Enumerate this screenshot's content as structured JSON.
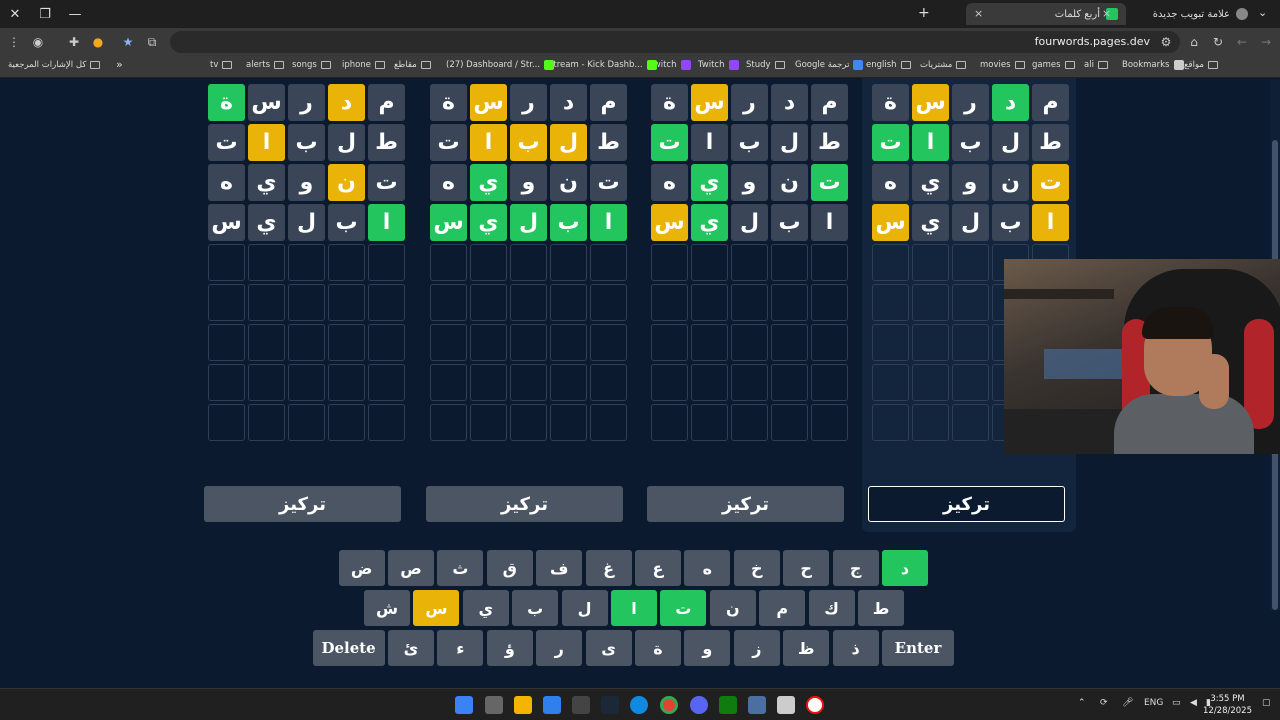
{
  "browser": {
    "tabs": [
      {
        "title": "أربع كلمات",
        "active": true
      },
      {
        "title": "علامة تبويب جديدة",
        "active": false
      }
    ],
    "new_tab_symbol": "+",
    "close_symbol": "×",
    "url": "fourwords.pages.dev",
    "bookmarks_bar": [
      {
        "label": "Bookmarks",
        "icon": "star-icon"
      },
      {
        "label": "مواقع",
        "icon": "folder-icon"
      },
      {
        "label": "ali",
        "icon": "folder-icon"
      },
      {
        "label": "games",
        "icon": "folder-icon"
      },
      {
        "label": "movies",
        "icon": "folder-icon"
      },
      {
        "label": "مشتريات",
        "icon": "folder-icon"
      },
      {
        "label": "english",
        "icon": "folder-icon"
      },
      {
        "label": "Google ترجمة",
        "icon": "translate-icon"
      },
      {
        "label": "Study",
        "icon": "folder-icon"
      },
      {
        "label": "Twitch",
        "icon": "twitch-icon"
      },
      {
        "label": "Twitch",
        "icon": "twitch-icon"
      },
      {
        "label": "Stream - Kick Dashb...",
        "icon": "kick-icon"
      },
      {
        "label": "(27) Dashboard / Str...",
        "icon": "kick-icon"
      },
      {
        "label": "مقاطع",
        "icon": "folder-icon"
      },
      {
        "label": "iphone",
        "icon": "folder-icon"
      },
      {
        "label": "songs",
        "icon": "folder-icon"
      },
      {
        "label": "alerts",
        "icon": "folder-icon"
      },
      {
        "label": "tv",
        "icon": "folder-icon"
      }
    ],
    "all_bookmarks": "كل الإشارات المرجعية",
    "overflow": "»"
  },
  "game": {
    "boards": [
      {
        "rows": [
          [
            {
              "l": "م",
              "s": "gray"
            },
            {
              "l": "د",
              "s": "green"
            },
            {
              "l": "ر",
              "s": "gray"
            },
            {
              "l": "س",
              "s": "yellow"
            },
            {
              "l": "ة",
              "s": "gray"
            }
          ],
          [
            {
              "l": "ط",
              "s": "gray"
            },
            {
              "l": "ل",
              "s": "gray"
            },
            {
              "l": "ب",
              "s": "gray"
            },
            {
              "l": "ا",
              "s": "green"
            },
            {
              "l": "ت",
              "s": "green"
            }
          ],
          [
            {
              "l": "ت",
              "s": "yellow"
            },
            {
              "l": "ن",
              "s": "gray"
            },
            {
              "l": "و",
              "s": "gray"
            },
            {
              "l": "ي",
              "s": "gray"
            },
            {
              "l": "ه",
              "s": "gray"
            }
          ],
          [
            {
              "l": "ا",
              "s": "yellow"
            },
            {
              "l": "ب",
              "s": "gray"
            },
            {
              "l": "ل",
              "s": "gray"
            },
            {
              "l": "ي",
              "s": "gray"
            },
            {
              "l": "س",
              "s": "yellow"
            }
          ]
        ],
        "focus_label": "تركيز",
        "active": true
      },
      {
        "rows": [
          [
            {
              "l": "م",
              "s": "gray"
            },
            {
              "l": "د",
              "s": "gray"
            },
            {
              "l": "ر",
              "s": "gray"
            },
            {
              "l": "س",
              "s": "yellow"
            },
            {
              "l": "ة",
              "s": "gray"
            }
          ],
          [
            {
              "l": "ط",
              "s": "gray"
            },
            {
              "l": "ل",
              "s": "gray"
            },
            {
              "l": "ب",
              "s": "gray"
            },
            {
              "l": "ا",
              "s": "gray"
            },
            {
              "l": "ت",
              "s": "green"
            }
          ],
          [
            {
              "l": "ت",
              "s": "green"
            },
            {
              "l": "ن",
              "s": "gray"
            },
            {
              "l": "و",
              "s": "gray"
            },
            {
              "l": "ي",
              "s": "green"
            },
            {
              "l": "ه",
              "s": "gray"
            }
          ],
          [
            {
              "l": "ا",
              "s": "gray"
            },
            {
              "l": "ب",
              "s": "gray"
            },
            {
              "l": "ل",
              "s": "gray"
            },
            {
              "l": "ي",
              "s": "green"
            },
            {
              "l": "س",
              "s": "yellow"
            }
          ]
        ],
        "focus_label": "تركيز",
        "active": false
      },
      {
        "rows": [
          [
            {
              "l": "م",
              "s": "gray"
            },
            {
              "l": "د",
              "s": "gray"
            },
            {
              "l": "ر",
              "s": "gray"
            },
            {
              "l": "س",
              "s": "yellow"
            },
            {
              "l": "ة",
              "s": "gray"
            }
          ],
          [
            {
              "l": "ط",
              "s": "gray"
            },
            {
              "l": "ل",
              "s": "yellow"
            },
            {
              "l": "ب",
              "s": "yellow"
            },
            {
              "l": "ا",
              "s": "yellow"
            },
            {
              "l": "ت",
              "s": "gray"
            }
          ],
          [
            {
              "l": "ت",
              "s": "gray"
            },
            {
              "l": "ن",
              "s": "gray"
            },
            {
              "l": "و",
              "s": "gray"
            },
            {
              "l": "ي",
              "s": "green"
            },
            {
              "l": "ه",
              "s": "gray"
            }
          ],
          [
            {
              "l": "ا",
              "s": "green"
            },
            {
              "l": "ب",
              "s": "green"
            },
            {
              "l": "ل",
              "s": "green"
            },
            {
              "l": "ي",
              "s": "green"
            },
            {
              "l": "س",
              "s": "green"
            }
          ]
        ],
        "focus_label": "تركيز",
        "active": false
      },
      {
        "rows": [
          [
            {
              "l": "م",
              "s": "gray"
            },
            {
              "l": "د",
              "s": "yellow"
            },
            {
              "l": "ر",
              "s": "gray"
            },
            {
              "l": "س",
              "s": "gray"
            },
            {
              "l": "ة",
              "s": "green"
            }
          ],
          [
            {
              "l": "ط",
              "s": "gray"
            },
            {
              "l": "ل",
              "s": "gray"
            },
            {
              "l": "ب",
              "s": "gray"
            },
            {
              "l": "ا",
              "s": "yellow"
            },
            {
              "l": "ت",
              "s": "gray"
            }
          ],
          [
            {
              "l": "ت",
              "s": "gray"
            },
            {
              "l": "ن",
              "s": "yellow"
            },
            {
              "l": "و",
              "s": "gray"
            },
            {
              "l": "ي",
              "s": "gray"
            },
            {
              "l": "ه",
              "s": "gray"
            }
          ],
          [
            {
              "l": "ا",
              "s": "green"
            },
            {
              "l": "ب",
              "s": "gray"
            },
            {
              "l": "ل",
              "s": "gray"
            },
            {
              "l": "ي",
              "s": "gray"
            },
            {
              "l": "س",
              "s": "gray"
            }
          ]
        ],
        "focus_label": "تركيز",
        "active": false
      }
    ],
    "total_rows": 9,
    "keyboard": [
      [
        {
          "k": "د",
          "s": "green"
        },
        {
          "k": "ج",
          "s": "gray"
        },
        {
          "k": "ح",
          "s": "gray"
        },
        {
          "k": "خ",
          "s": "gray"
        },
        {
          "k": "ه",
          "s": "gray"
        },
        {
          "k": "ع",
          "s": "gray"
        },
        {
          "k": "غ",
          "s": "gray"
        },
        {
          "k": "ف",
          "s": "gray"
        },
        {
          "k": "ق",
          "s": "gray"
        },
        {
          "k": "ث",
          "s": "gray"
        },
        {
          "k": "ص",
          "s": "gray"
        },
        {
          "k": "ض",
          "s": "gray"
        }
      ],
      [
        {
          "k": "ط",
          "s": "gray"
        },
        {
          "k": "ك",
          "s": "gray"
        },
        {
          "k": "م",
          "s": "gray"
        },
        {
          "k": "ن",
          "s": "gray"
        },
        {
          "k": "ت",
          "s": "green"
        },
        {
          "k": "ا",
          "s": "green"
        },
        {
          "k": "ل",
          "s": "gray"
        },
        {
          "k": "ب",
          "s": "gray"
        },
        {
          "k": "ي",
          "s": "gray"
        },
        {
          "k": "س",
          "s": "yellow"
        },
        {
          "k": "ش",
          "s": "gray"
        }
      ],
      [
        {
          "k": "Enter",
          "s": "gray",
          "wide": true
        },
        {
          "k": "ذ",
          "s": "gray"
        },
        {
          "k": "ظ",
          "s": "gray"
        },
        {
          "k": "ز",
          "s": "gray"
        },
        {
          "k": "و",
          "s": "gray"
        },
        {
          "k": "ة",
          "s": "gray"
        },
        {
          "k": "ى",
          "s": "gray"
        },
        {
          "k": "ر",
          "s": "gray"
        },
        {
          "k": "ؤ",
          "s": "gray"
        },
        {
          "k": "ء",
          "s": "gray"
        },
        {
          "k": "ئ",
          "s": "gray"
        },
        {
          "k": "Delete",
          "s": "gray",
          "wide": true
        }
      ]
    ]
  },
  "taskbar": {
    "lang": "ENG",
    "time": "3:55 PM",
    "date": "12/28/2025"
  },
  "colors": {
    "green": "#22c55e",
    "yellow": "#eab308",
    "gray": "#3a4657",
    "background": "#0b1a2e"
  }
}
